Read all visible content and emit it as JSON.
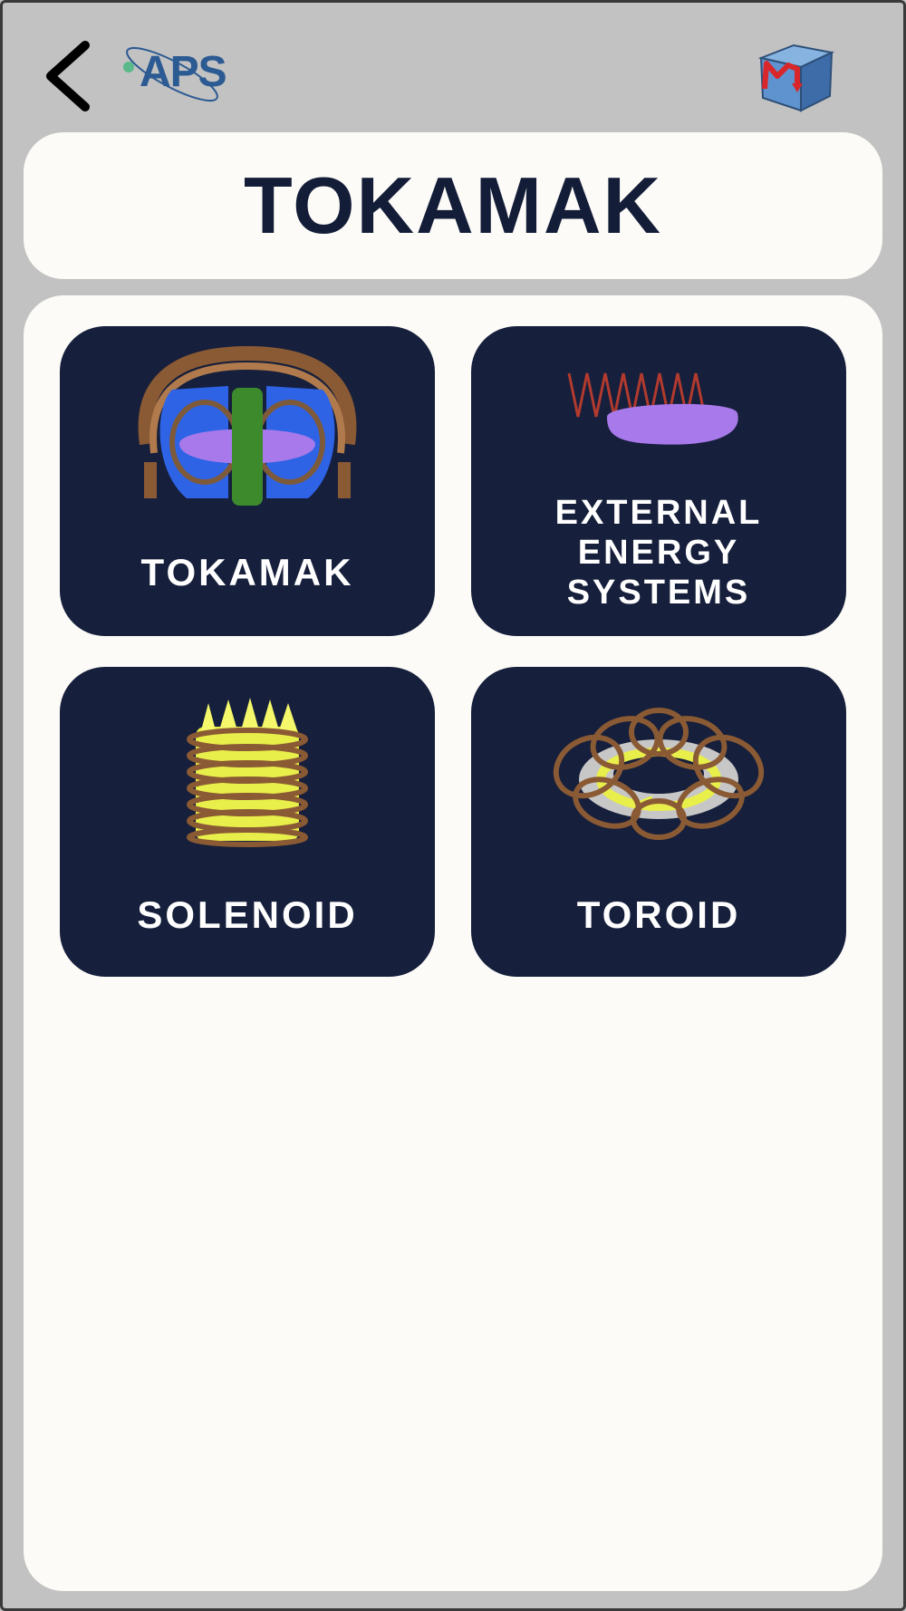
{
  "header": {
    "back_icon": "chevron-left-icon",
    "logo_text": "APS",
    "cube_icon": "magnetism-cube-icon"
  },
  "title": "TOKAMAK",
  "tiles": [
    {
      "label": "TOKAMAK",
      "icon": "tokamak-icon"
    },
    {
      "label_lines": [
        "EXTERNAL",
        "ENERGY",
        "SYSTEMS"
      ],
      "icon": "external-energy-icon"
    },
    {
      "label": "SOLENOID",
      "icon": "solenoid-icon"
    },
    {
      "label": "TOROID",
      "icon": "toroid-icon"
    }
  ],
  "colors": {
    "background": "#c2c2c2",
    "card": "#fcfbf7",
    "tile": "#161f3b",
    "title_text": "#141d38",
    "tile_text": "#ffffff",
    "logo_blue": "#2c5a93"
  }
}
